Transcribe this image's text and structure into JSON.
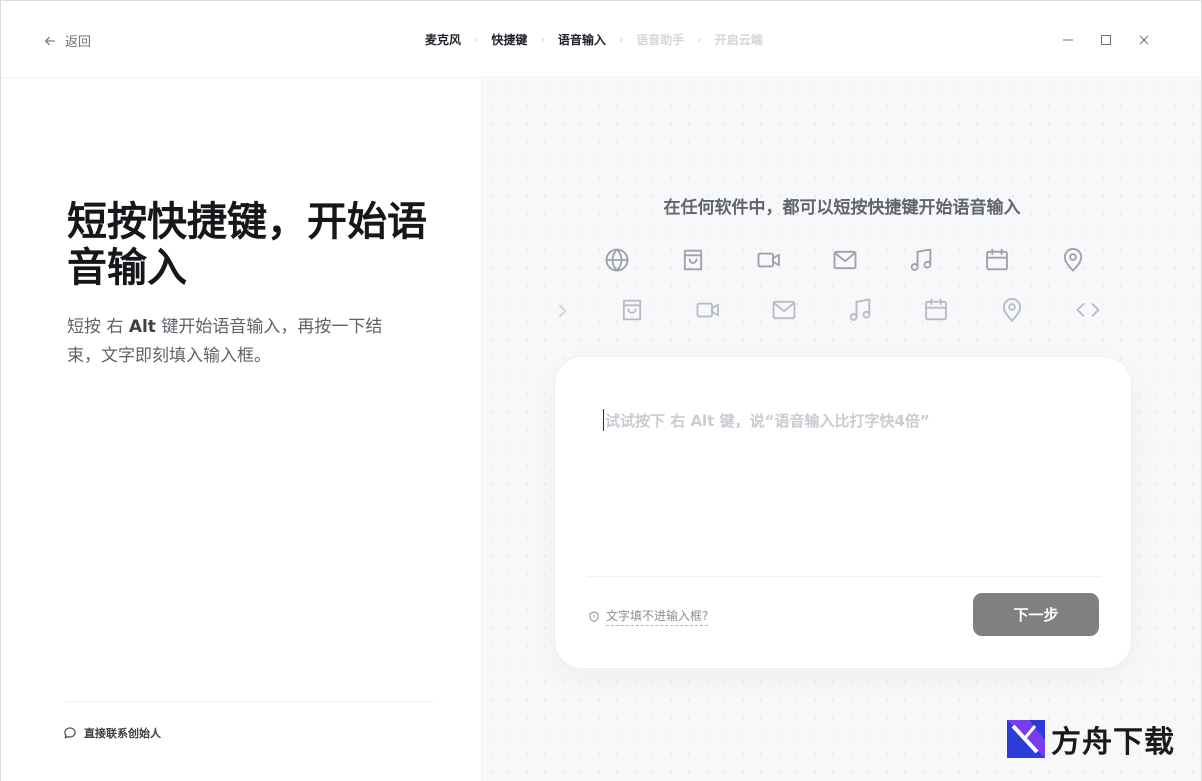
{
  "titlebar": {
    "back_label": "返回",
    "steps": [
      {
        "label": "麦克风",
        "active": true
      },
      {
        "label": "快捷键",
        "active": true
      },
      {
        "label": "语音输入",
        "active": true
      },
      {
        "label": "语音助手",
        "active": false
      },
      {
        "label": "开启云端",
        "active": false
      }
    ],
    "separator": "›",
    "controls": [
      "minimize-icon",
      "maximize-icon",
      "close-icon"
    ]
  },
  "left": {
    "headline": "短按快捷键，开始语音输入",
    "description_prefix": "短按 右 ",
    "description_key": "Alt",
    "description_suffix": " 键开始语音输入，再按一下结束，文字即刻填入输入框。",
    "contact_label": "直接联系创始人"
  },
  "right": {
    "title": "在任何软件中，都可以短按快捷键开始语音输入",
    "icons_row1": [
      "globe-icon",
      "shopping-bag-icon",
      "video-icon",
      "mail-icon",
      "music-icon",
      "calendar-icon",
      "location-icon"
    ],
    "icons_row2": [
      "shopping-bag-icon",
      "video-icon",
      "mail-icon",
      "music-icon",
      "calendar-icon",
      "location-icon",
      "code-icon"
    ],
    "card": {
      "placeholder": "试试按下 右 Alt 键，说“语音输入比打字快4倍”",
      "help_label": "文字填不进输入框?",
      "next_button": "下一步"
    }
  },
  "watermark": {
    "text": "方舟下载"
  },
  "colors": {
    "button_bg": "#808080",
    "right_bg": "#f7f8fa",
    "headline": "#15171a"
  }
}
